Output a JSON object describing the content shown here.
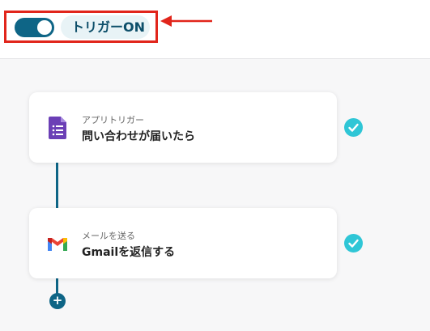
{
  "header": {
    "trigger_toggle_state": "on",
    "trigger_label": "トリガーON"
  },
  "steps": [
    {
      "subtitle": "アプリトリガー",
      "title": "問い合わせが届いたら",
      "icon": "google-forms-icon",
      "status": "completed"
    },
    {
      "subtitle": "メールを送る",
      "title": "Gmailを返信する",
      "icon": "gmail-icon",
      "status": "completed"
    }
  ],
  "add_step": "+",
  "colors": {
    "accent": "#0e6586",
    "check": "#2fc6d6",
    "annotation": "#e1251b"
  }
}
